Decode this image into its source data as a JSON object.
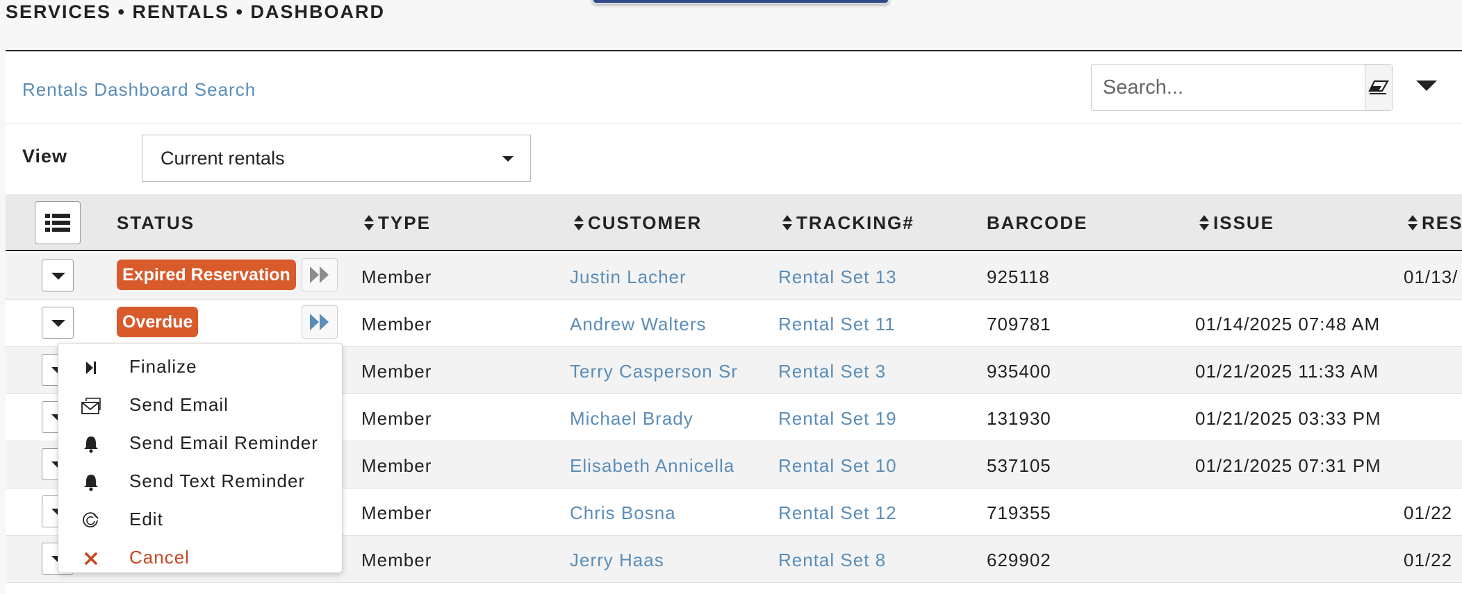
{
  "breadcrumb": "SERVICES • RENTALS • DASHBOARD",
  "colors": {
    "accent": "#5a8db8",
    "badge_orange": "#d95a2b",
    "cancel_red": "#c8451f"
  },
  "search": {
    "title": "Rentals Dashboard Search",
    "placeholder": "Search..."
  },
  "view": {
    "label": "View",
    "selected": "Current rentals"
  },
  "table": {
    "headers": {
      "status": "STATUS",
      "type": "TYPE",
      "customer": "CUSTOMER",
      "tracking": "TRACKING#",
      "barcode": "BARCODE",
      "issue": "ISSUE",
      "res": "RES"
    },
    "rows": [
      {
        "status": "Expired Reservation",
        "type": "Member",
        "customer": "Justin Lacher",
        "tracking": "Rental Set 13",
        "barcode": "925118",
        "issue": "",
        "res": "01/13/"
      },
      {
        "status": "Overdue",
        "type": "Member",
        "customer": "Andrew Walters",
        "tracking": "Rental Set 11",
        "barcode": "709781",
        "issue": "01/14/2025 07:48 AM",
        "res": ""
      },
      {
        "status": "",
        "type": "Member",
        "customer": "Terry Casperson Sr",
        "tracking": "Rental Set 3",
        "barcode": "935400",
        "issue": "01/21/2025 11:33 AM",
        "res": ""
      },
      {
        "status": "",
        "type": "Member",
        "customer": "Michael Brady",
        "tracking": "Rental Set 19",
        "barcode": "131930",
        "issue": "01/21/2025 03:33 PM",
        "res": ""
      },
      {
        "status": "",
        "type": "Member",
        "customer": "Elisabeth Annicella",
        "tracking": "Rental Set 10",
        "barcode": "537105",
        "issue": "01/21/2025 07:31 PM",
        "res": ""
      },
      {
        "status": "",
        "type": "Member",
        "customer": "Chris Bosna",
        "tracking": "Rental Set 12",
        "barcode": "719355",
        "issue": "",
        "res": "01/22"
      },
      {
        "status": "",
        "type": "Member",
        "customer": "Jerry Haas",
        "tracking": "Rental Set 8",
        "barcode": "629902",
        "issue": "",
        "res": "01/22"
      }
    ]
  },
  "menu": {
    "items": [
      {
        "label": "Finalize",
        "icon": "skip-forward-icon"
      },
      {
        "label": "Send Email",
        "icon": "envelope-icon"
      },
      {
        "label": "Send Email Reminder",
        "icon": "bell-icon"
      },
      {
        "label": "Send Text Reminder",
        "icon": "bell-icon"
      },
      {
        "label": "Edit",
        "icon": "edit-icon"
      },
      {
        "label": "Cancel",
        "icon": "close-icon"
      }
    ]
  }
}
